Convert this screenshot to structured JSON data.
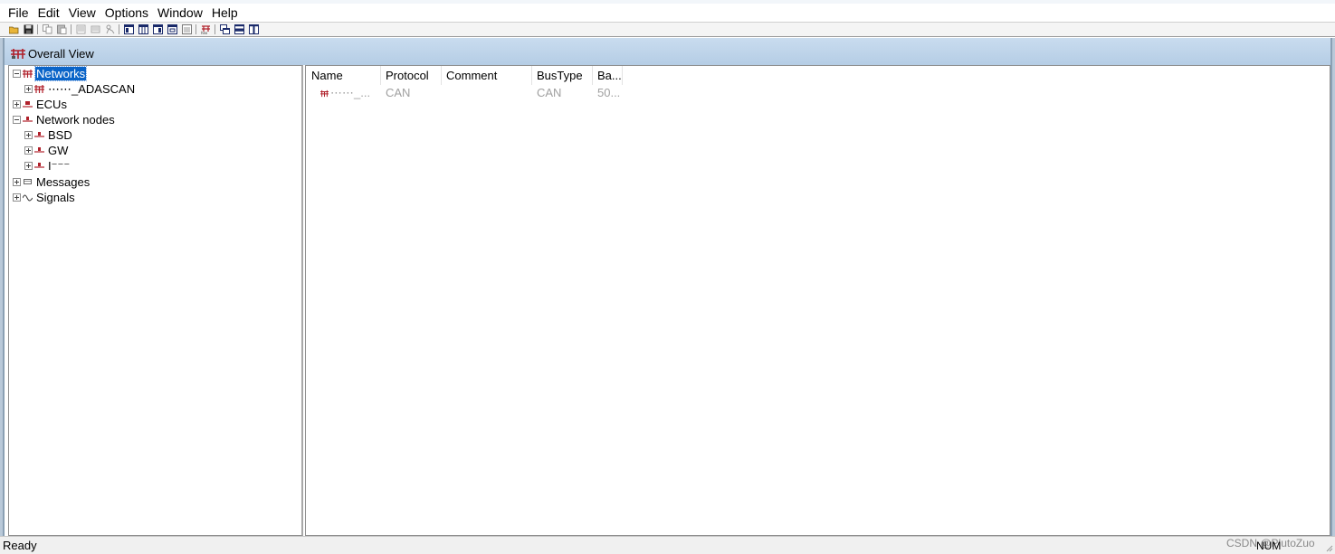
{
  "menubar": {
    "items": [
      {
        "label": "File"
      },
      {
        "label": "Edit"
      },
      {
        "label": "View"
      },
      {
        "label": "Options"
      },
      {
        "label": "Window"
      },
      {
        "label": "Help"
      }
    ]
  },
  "toolbar": {
    "icons": [
      "open-icon",
      "save-icon",
      "copy-icon",
      "paste-icon",
      "properties-icon",
      "list-icon",
      "print-icon",
      "view-1-icon",
      "view-2-icon",
      "view-3-icon",
      "view-4-icon",
      "view-5-icon",
      "network-icon",
      "cascade-icon",
      "tile-horizontal-icon",
      "tile-vertical-icon"
    ]
  },
  "window": {
    "title": "Overall View"
  },
  "tree": {
    "networks": "Networks",
    "network_child": "⋯⋯_ADASCAN",
    "ecus": "ECUs",
    "network_nodes": "Network nodes",
    "node_bsd": "BSD",
    "node_gw": "GW",
    "node_third": "I⁻⁻⁻",
    "messages": "Messages",
    "signals": "Signals"
  },
  "list": {
    "columns": [
      "Name",
      "Protocol",
      "Comment",
      "BusType",
      "Ba..."
    ],
    "rows": [
      {
        "name": "⋯⋯_...",
        "protocol": "CAN",
        "comment": "",
        "bustype": "CAN",
        "baudrate": "50..."
      }
    ]
  },
  "status": {
    "text": "Ready",
    "num": "NUM",
    "watermark": "CSDN @PlutoZuo"
  },
  "colors": {
    "selection": "#0a64c8",
    "title_bar": "#b5cde5",
    "node_icon": "#b0202a"
  }
}
